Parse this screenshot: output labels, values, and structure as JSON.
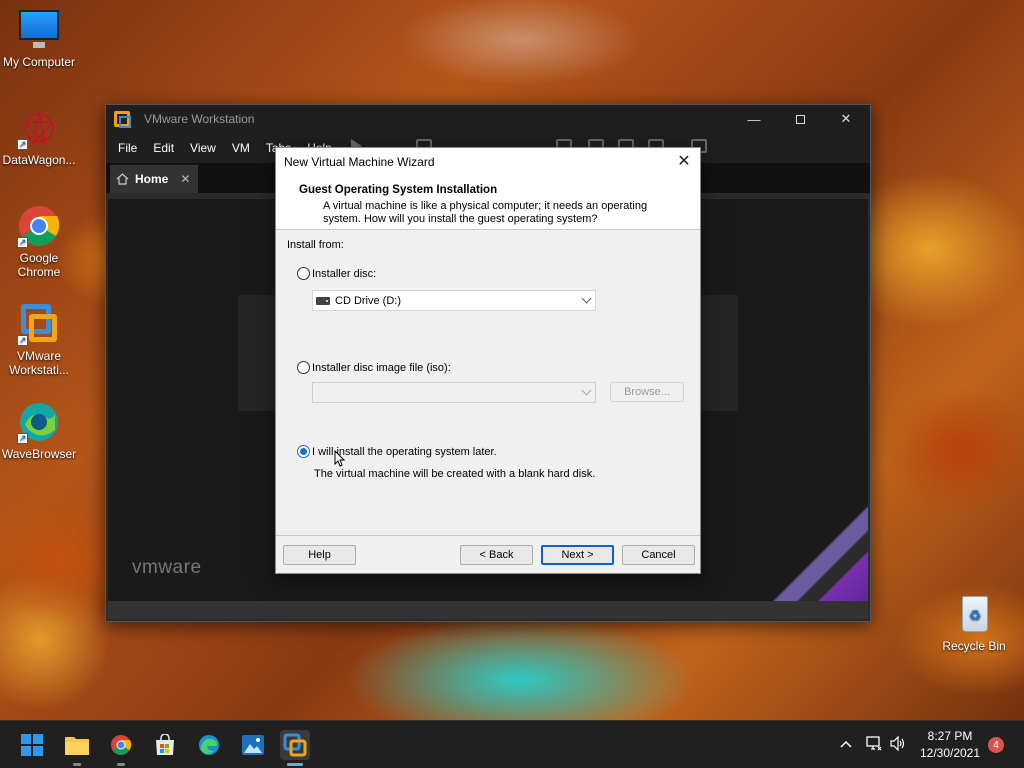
{
  "desktop": {
    "icons": [
      {
        "label": "My Computer"
      },
      {
        "label": "DataWagon..."
      },
      {
        "label": "Google\nChrome"
      },
      {
        "label": "VMware\nWorkstati..."
      },
      {
        "label": "WaveBrowser"
      }
    ],
    "recycle_bin": "Recycle Bin"
  },
  "vmware": {
    "title": "VMware Workstation",
    "menu": [
      "File",
      "Edit",
      "View",
      "VM",
      "Tabs",
      "Help"
    ],
    "tab_home": "Home",
    "brand": "vmware"
  },
  "wizard": {
    "title": "New Virtual Machine Wizard",
    "heading": "Guest Operating System Installation",
    "description": "A virtual machine is like a physical computer; it needs an operating system. How will you install the guest operating system?",
    "install_from": "Install from:",
    "opt_disc": "Installer disc:",
    "disc_value": "CD Drive (D:)",
    "opt_iso": "Installer disc image file (iso):",
    "iso_value": "",
    "browse": "Browse...",
    "opt_later": "I will install the operating system later.",
    "later_note": "The virtual machine will be created with a blank hard disk.",
    "selected_option": "later",
    "buttons": {
      "help": "Help",
      "back": "< Back",
      "next": "Next >",
      "cancel": "Cancel"
    }
  },
  "taskbar": {
    "apps": [
      "start-icon",
      "file-explorer-icon",
      "chrome-icon",
      "store-icon",
      "edge-icon",
      "photos-icon",
      "vmware-icon"
    ],
    "time": "8:27 PM",
    "date": "12/30/2021",
    "notifications": "4"
  }
}
